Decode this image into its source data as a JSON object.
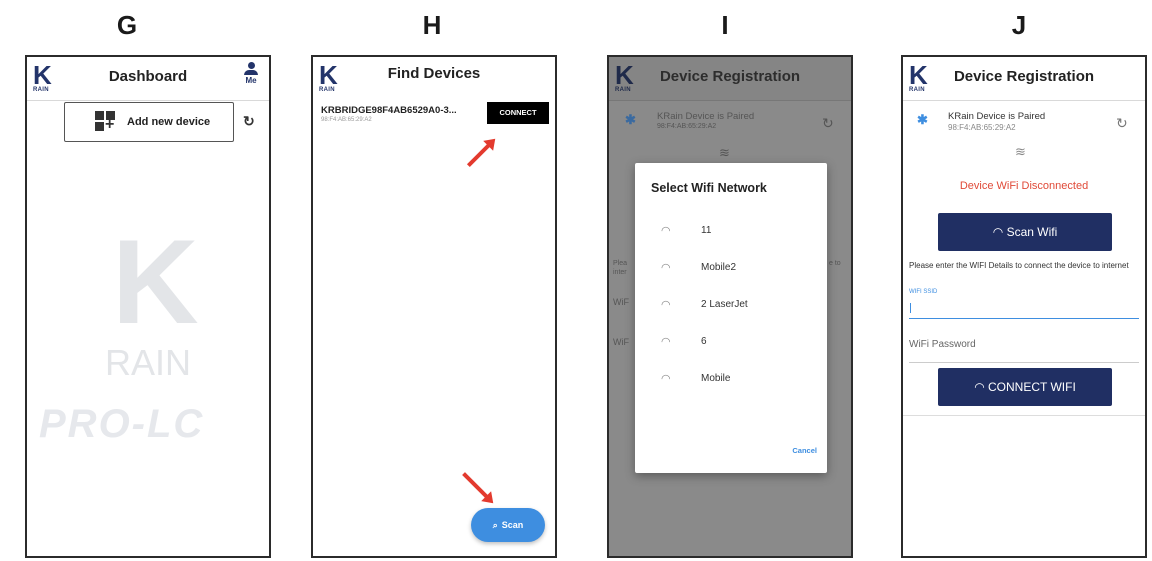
{
  "panels": {
    "g": {
      "letter": "G",
      "app_title": "Dashboard",
      "logo": {
        "mark": "K",
        "sub": "RAIN"
      },
      "profile_label": "Me",
      "add_device_label": "Add new device",
      "refresh_icon": "refresh-icon",
      "watermark": {
        "mark": "K",
        "brand": "RAIN",
        "product": "PRO-LC"
      }
    },
    "h": {
      "letter": "H",
      "app_title": "Find Devices",
      "logo": {
        "mark": "K",
        "sub": "RAIN"
      },
      "device": {
        "name": "KRBRIDGE98F4AB6529A0-3...",
        "mac": "98:F4:AB:65:29:A2"
      },
      "connect_label": "CONNECT",
      "scan_label": "Scan",
      "arrow_color": "#e33a2e"
    },
    "i": {
      "letter": "I",
      "app_title": "Device Registration",
      "logo": {
        "mark": "K",
        "sub": "RAIN"
      },
      "paired_text": "KRain Device is Paired",
      "paired_mac": "98:F4:AB:65:29:A2",
      "dialog_title": "Select Wifi Network",
      "networks": [
        "11",
        "Mobile2",
        "2 LaserJet",
        "6",
        "Mobile"
      ],
      "cancel_label": "Cancel",
      "bg_fragments": {
        "please": "Plea",
        "internet": "inter",
        "to": "e to",
        "wifi1": "WiF",
        "wifi2": "WiF"
      }
    },
    "j": {
      "letter": "J",
      "app_title": "Device Registration",
      "logo": {
        "mark": "K",
        "sub": "RAIN"
      },
      "paired_text": "KRain Device is Paired",
      "paired_mac": "98:F4:AB:65:29:A2",
      "status_text": "Device WiFi Disconnected",
      "status_color": "#e04a38",
      "scan_wifi_label": "Scan Wifi",
      "hint_text": "Please enter the WIFI Details to connect the device to internet",
      "ssid_label": "WIFI SSID",
      "password_placeholder": "WiFi Password",
      "connect_wifi_label": "CONNECT WIFI",
      "accent": "#202f63"
    }
  }
}
